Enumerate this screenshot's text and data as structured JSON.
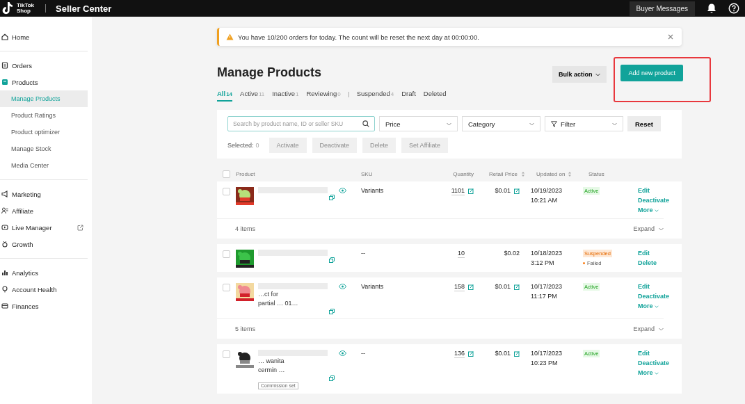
{
  "header": {
    "brand_top": "TikTok",
    "brand_bottom": "Shop",
    "title": "Seller Center",
    "buyer_messages": "Buyer Messages"
  },
  "sidebar": {
    "groups": [
      [
        {
          "label": "Home",
          "selected": false
        }
      ],
      [
        {
          "label": "Orders",
          "selected": false
        },
        {
          "label": "Products",
          "selected": false,
          "children": [
            {
              "label": "Manage Products",
              "selected": true
            },
            {
              "label": "Product Ratings",
              "selected": false
            },
            {
              "label": "Product optimizer",
              "selected": false
            },
            {
              "label": "Manage Stock",
              "selected": false
            },
            {
              "label": "Media Center",
              "selected": false
            }
          ]
        }
      ],
      [
        {
          "label": "Marketing",
          "selected": false
        },
        {
          "label": "Affiliate",
          "selected": false
        },
        {
          "label": "Live Manager",
          "selected": false,
          "external": true
        },
        {
          "label": "Growth",
          "selected": false
        }
      ],
      [
        {
          "label": "Analytics",
          "selected": false
        },
        {
          "label": "Account Health",
          "selected": false
        },
        {
          "label": "Finances",
          "selected": false
        }
      ]
    ]
  },
  "notice": {
    "text": "You have 10/200 orders for today. The count will be reset the next day at 00:00:00."
  },
  "page_title": "Manage Products",
  "bulk_action": "Bulk action",
  "add_button": "Add new product",
  "tabs": [
    {
      "label": "All",
      "count": "14",
      "selected": true
    },
    {
      "label": "Active",
      "count": "11",
      "selected": false
    },
    {
      "label": "Inactive",
      "count": "1",
      "selected": false
    },
    {
      "label": "Reviewing",
      "count": "0",
      "selected": false
    },
    {
      "label": "Suspended",
      "count": "4",
      "selected": false,
      "divider_before": true
    },
    {
      "label": "Draft",
      "selected": false
    },
    {
      "label": "Deleted",
      "selected": false
    }
  ],
  "filters": {
    "search_placeholder": "Search by product name, ID or seller SKU",
    "selects": [
      {
        "label": "Price",
        "kind": "select"
      },
      {
        "label": "Category",
        "kind": "select"
      },
      {
        "label": "Filter",
        "kind": "filter"
      }
    ],
    "reset": "Reset"
  },
  "bulk_bar": {
    "selected_label": "Selected:",
    "selected_count": "0",
    "actions": [
      {
        "label": "Activate",
        "disabled": true
      },
      {
        "label": "Deactivate",
        "disabled": true
      },
      {
        "label": "Delete",
        "disabled": true
      },
      {
        "label": "Set Affiliate",
        "disabled": true
      }
    ]
  },
  "table": {
    "select_all": {
      "checked": false
    },
    "columns": [
      {
        "label": "Product"
      },
      {
        "label": "SKU"
      },
      {
        "label": "Quantity"
      },
      {
        "label": "Retail Price",
        "sortable": true
      },
      {
        "label": "Updated on",
        "sortable": true
      },
      {
        "label": "Status"
      }
    ],
    "rows": [
      {
        "checked": false,
        "name_lines": [],
        "viewable": true,
        "sku": "Variants",
        "quantity": "1101",
        "quantity_editable": true,
        "price": "$0.01",
        "price_editable": true,
        "date": "10/19/2023",
        "time": "10:21 AM",
        "status": {
          "kind": "active",
          "label": "Active"
        },
        "actions": [
          "Edit",
          "Deactivate"
        ],
        "more": "More",
        "items": {
          "count": "4 items",
          "expand": "Expand"
        }
      },
      {
        "checked": false,
        "name_lines": [],
        "viewable": false,
        "sku": "--",
        "quantity": "10",
        "quantity_editable": false,
        "price": "$0.02",
        "price_editable": false,
        "date": "10/18/2023",
        "time": "3:12 PM",
        "status": {
          "kind": "suspended",
          "label": "Suspended",
          "detail": "Failed"
        },
        "actions": [
          "Edit",
          "Delete"
        ]
      },
      {
        "checked": false,
        "name_lines": [
          "…ct for",
          "partial … 01…"
        ],
        "viewable": true,
        "sku": "Variants",
        "quantity": "158",
        "quantity_editable": true,
        "price": "$0.01",
        "price_editable": true,
        "date": "10/17/2023",
        "time": "11:17 PM",
        "status": {
          "kind": "active",
          "label": "Active"
        },
        "actions": [
          "Edit",
          "Deactivate"
        ],
        "more": "More",
        "items": {
          "count": "5 items",
          "expand": "Expand"
        }
      },
      {
        "checked": false,
        "name_lines": [
          "… wanita",
          "cermin …"
        ],
        "viewable": true,
        "sku": "--",
        "quantity": "136",
        "quantity_editable": true,
        "price": "$0.01",
        "price_editable": true,
        "date": "10/17/2023",
        "time": "10:23 PM",
        "status": {
          "kind": "active",
          "label": "Active"
        },
        "actions": [
          "Edit",
          "Deactivate"
        ],
        "more": "More",
        "tag": "Commission set"
      }
    ]
  }
}
